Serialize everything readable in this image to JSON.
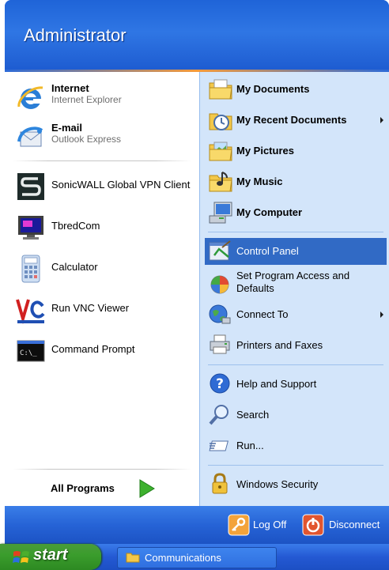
{
  "header": {
    "username": "Administrator"
  },
  "pinned": [
    {
      "title": "Internet",
      "subtitle": "Internet Explorer"
    },
    {
      "title": "E-mail",
      "subtitle": "Outlook Express"
    }
  ],
  "recent": [
    {
      "label": "SonicWALL Global VPN Client"
    },
    {
      "label": "TbredCom"
    },
    {
      "label": "Calculator"
    },
    {
      "label": "Run VNC Viewer"
    },
    {
      "label": "Command Prompt"
    }
  ],
  "all_programs": "All Programs",
  "right": {
    "my_documents": "My Documents",
    "my_recent_documents": "My Recent Documents",
    "my_pictures": "My Pictures",
    "my_music": "My Music",
    "my_computer": "My Computer",
    "control_panel": "Control Panel",
    "set_program_access_line1": "Set Program Access and",
    "set_program_access_line2": "Defaults",
    "connect_to": "Connect To",
    "printers_faxes": "Printers and Faxes",
    "help_support": "Help and Support",
    "search": "Search",
    "run": "Run...",
    "windows_security": "Windows Security"
  },
  "footer": {
    "log_off": "Log Off",
    "disconnect": "Disconnect"
  },
  "taskbar": {
    "start": "start",
    "task": "Communications"
  },
  "colors": {
    "header_blue": "#1f64d8",
    "right_panel": "#d3e5fa",
    "highlight": "#316ac5",
    "start_green": "#3b9d2d"
  }
}
